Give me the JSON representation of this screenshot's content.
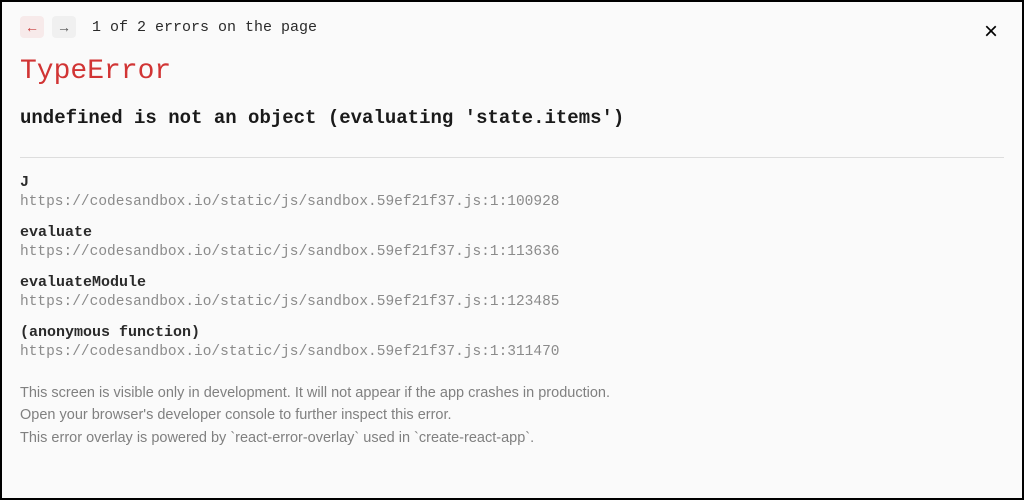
{
  "nav": {
    "counter": "1 of 2 errors on the page"
  },
  "error": {
    "type": "TypeError",
    "message": "undefined is not an object (evaluating 'state.items')"
  },
  "stack": [
    {
      "name": "J",
      "location": "https://codesandbox.io/static/js/sandbox.59ef21f37.js:1:100928"
    },
    {
      "name": "evaluate",
      "location": "https://codesandbox.io/static/js/sandbox.59ef21f37.js:1:113636"
    },
    {
      "name": "evaluateModule",
      "location": "https://codesandbox.io/static/js/sandbox.59ef21f37.js:1:123485"
    },
    {
      "name": "(anonymous function)",
      "location": "https://codesandbox.io/static/js/sandbox.59ef21f37.js:1:311470"
    }
  ],
  "footer": {
    "line1": "This screen is visible only in development. It will not appear if the app crashes in production.",
    "line2": "Open your browser's developer console to further inspect this error.",
    "line3": "This error overlay is powered by `react-error-overlay` used in `create-react-app`."
  }
}
